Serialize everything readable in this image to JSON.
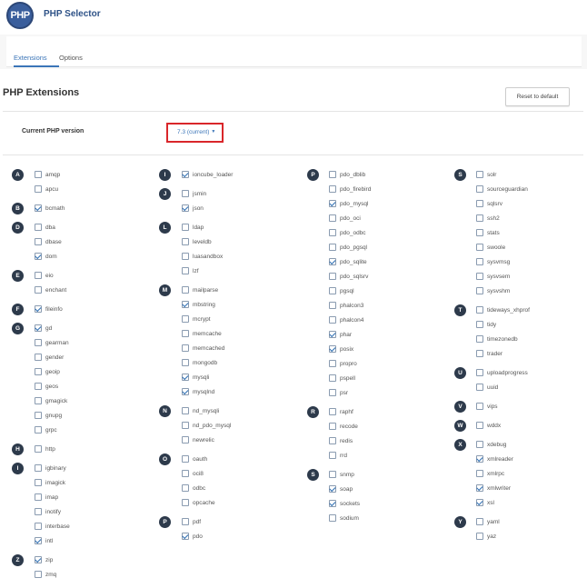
{
  "app": {
    "logo_text": "PHP",
    "title": "PHP Selector"
  },
  "tabs": [
    {
      "label": "Extensions",
      "active": true
    },
    {
      "label": "Options",
      "active": false
    }
  ],
  "section_title": "PHP Extensions",
  "reset_button": "Reset to default",
  "version": {
    "label": "Current PHP version",
    "selected": "7.3 (current)"
  },
  "colors": {
    "accent": "#3b75b8",
    "letter_badge": "#2d3a4b",
    "highlight_border": "#d9262a"
  },
  "columns": [
    [
      {
        "letter": "A",
        "items": [
          {
            "name": "amqp",
            "checked": false
          },
          {
            "name": "apcu",
            "checked": false
          }
        ]
      },
      {
        "letter": "B",
        "items": [
          {
            "name": "bcmath",
            "checked": true
          }
        ]
      },
      {
        "letter": "D",
        "items": [
          {
            "name": "dba",
            "checked": false
          },
          {
            "name": "dbase",
            "checked": false
          },
          {
            "name": "dom",
            "checked": true
          }
        ]
      },
      {
        "letter": "E",
        "items": [
          {
            "name": "eio",
            "checked": false
          },
          {
            "name": "enchant",
            "checked": false
          }
        ]
      },
      {
        "letter": "F",
        "items": [
          {
            "name": "fileinfo",
            "checked": true
          }
        ]
      },
      {
        "letter": "G",
        "items": [
          {
            "name": "gd",
            "checked": true
          },
          {
            "name": "gearman",
            "checked": false
          },
          {
            "name": "gender",
            "checked": false
          },
          {
            "name": "geoip",
            "checked": false
          },
          {
            "name": "geos",
            "checked": false
          },
          {
            "name": "gmagick",
            "checked": false
          },
          {
            "name": "gnupg",
            "checked": false
          },
          {
            "name": "grpc",
            "checked": false
          }
        ]
      },
      {
        "letter": "H",
        "items": [
          {
            "name": "http",
            "checked": false
          }
        ]
      },
      {
        "letter": "I",
        "items": [
          {
            "name": "igbinary",
            "checked": false
          },
          {
            "name": "imagick",
            "checked": false
          },
          {
            "name": "imap",
            "checked": false
          },
          {
            "name": "inotify",
            "checked": false
          },
          {
            "name": "interbase",
            "checked": false
          },
          {
            "name": "intl",
            "checked": true
          }
        ]
      },
      {
        "letter": "Z",
        "items": [
          {
            "name": "zip",
            "checked": true
          },
          {
            "name": "zmq",
            "checked": false
          }
        ]
      }
    ],
    [
      {
        "letter": "I",
        "items": [
          {
            "name": "ioncube_loader",
            "checked": true
          }
        ]
      },
      {
        "letter": "J",
        "items": [
          {
            "name": "jsmin",
            "checked": false
          },
          {
            "name": "json",
            "checked": true
          }
        ]
      },
      {
        "letter": "L",
        "items": [
          {
            "name": "ldap",
            "checked": false
          },
          {
            "name": "leveldb",
            "checked": false
          },
          {
            "name": "luasandbox",
            "checked": false
          },
          {
            "name": "lzf",
            "checked": false
          }
        ]
      },
      {
        "letter": "M",
        "items": [
          {
            "name": "mailparse",
            "checked": false
          },
          {
            "name": "mbstring",
            "checked": true
          },
          {
            "name": "mcrypt",
            "checked": false
          },
          {
            "name": "memcache",
            "checked": false
          },
          {
            "name": "memcached",
            "checked": false
          },
          {
            "name": "mongodb",
            "checked": false
          },
          {
            "name": "mysqli",
            "checked": true
          },
          {
            "name": "mysqlnd",
            "checked": true
          }
        ]
      },
      {
        "letter": "N",
        "items": [
          {
            "name": "nd_mysqli",
            "checked": false
          },
          {
            "name": "nd_pdo_mysql",
            "checked": false
          },
          {
            "name": "newrelic",
            "checked": false
          }
        ]
      },
      {
        "letter": "O",
        "items": [
          {
            "name": "oauth",
            "checked": false
          },
          {
            "name": "oci8",
            "checked": false
          },
          {
            "name": "odbc",
            "checked": false
          },
          {
            "name": "opcache",
            "checked": false
          }
        ]
      },
      {
        "letter": "P",
        "items": [
          {
            "name": "pdf",
            "checked": false
          },
          {
            "name": "pdo",
            "checked": true
          }
        ]
      }
    ],
    [
      {
        "letter": "P",
        "items": [
          {
            "name": "pdo_dblib",
            "checked": false
          },
          {
            "name": "pdo_firebird",
            "checked": false
          },
          {
            "name": "pdo_mysql",
            "checked": true
          },
          {
            "name": "pdo_oci",
            "checked": false
          },
          {
            "name": "pdo_odbc",
            "checked": false
          },
          {
            "name": "pdo_pgsql",
            "checked": false
          },
          {
            "name": "pdo_sqlite",
            "checked": true
          },
          {
            "name": "pdo_sqlsrv",
            "checked": false
          },
          {
            "name": "pgsql",
            "checked": false
          },
          {
            "name": "phalcon3",
            "checked": false
          },
          {
            "name": "phalcon4",
            "checked": false
          },
          {
            "name": "phar",
            "checked": true
          },
          {
            "name": "posix",
            "checked": true
          },
          {
            "name": "propro",
            "checked": false
          },
          {
            "name": "pspell",
            "checked": false
          },
          {
            "name": "psr",
            "checked": false
          }
        ]
      },
      {
        "letter": "R",
        "items": [
          {
            "name": "raphf",
            "checked": false
          },
          {
            "name": "recode",
            "checked": false
          },
          {
            "name": "redis",
            "checked": false
          },
          {
            "name": "rrd",
            "checked": false
          }
        ]
      },
      {
        "letter": "S",
        "items": [
          {
            "name": "snmp",
            "checked": false
          },
          {
            "name": "soap",
            "checked": true
          },
          {
            "name": "sockets",
            "checked": true
          },
          {
            "name": "sodium",
            "checked": false
          }
        ]
      }
    ],
    [
      {
        "letter": "S",
        "items": [
          {
            "name": "solr",
            "checked": false
          },
          {
            "name": "sourceguardian",
            "checked": false
          },
          {
            "name": "sqlsrv",
            "checked": false
          },
          {
            "name": "ssh2",
            "checked": false
          },
          {
            "name": "stats",
            "checked": false
          },
          {
            "name": "swoole",
            "checked": false
          },
          {
            "name": "sysvmsg",
            "checked": false
          },
          {
            "name": "sysvsem",
            "checked": false
          },
          {
            "name": "sysvshm",
            "checked": false
          }
        ]
      },
      {
        "letter": "T",
        "items": [
          {
            "name": "tideways_xhprof",
            "checked": false
          },
          {
            "name": "tidy",
            "checked": false
          },
          {
            "name": "timezonedb",
            "checked": false
          },
          {
            "name": "trader",
            "checked": false
          }
        ]
      },
      {
        "letter": "U",
        "items": [
          {
            "name": "uploadprogress",
            "checked": false
          },
          {
            "name": "uuid",
            "checked": false
          }
        ]
      },
      {
        "letter": "V",
        "items": [
          {
            "name": "vips",
            "checked": false
          }
        ]
      },
      {
        "letter": "W",
        "items": [
          {
            "name": "wddx",
            "checked": false
          }
        ]
      },
      {
        "letter": "X",
        "items": [
          {
            "name": "xdebug",
            "checked": false
          },
          {
            "name": "xmlreader",
            "checked": true
          },
          {
            "name": "xmlrpc",
            "checked": false
          },
          {
            "name": "xmlwriter",
            "checked": true
          },
          {
            "name": "xsl",
            "checked": true
          }
        ]
      },
      {
        "letter": "Y",
        "items": [
          {
            "name": "yaml",
            "checked": false
          },
          {
            "name": "yaz",
            "checked": false
          }
        ]
      }
    ]
  ]
}
